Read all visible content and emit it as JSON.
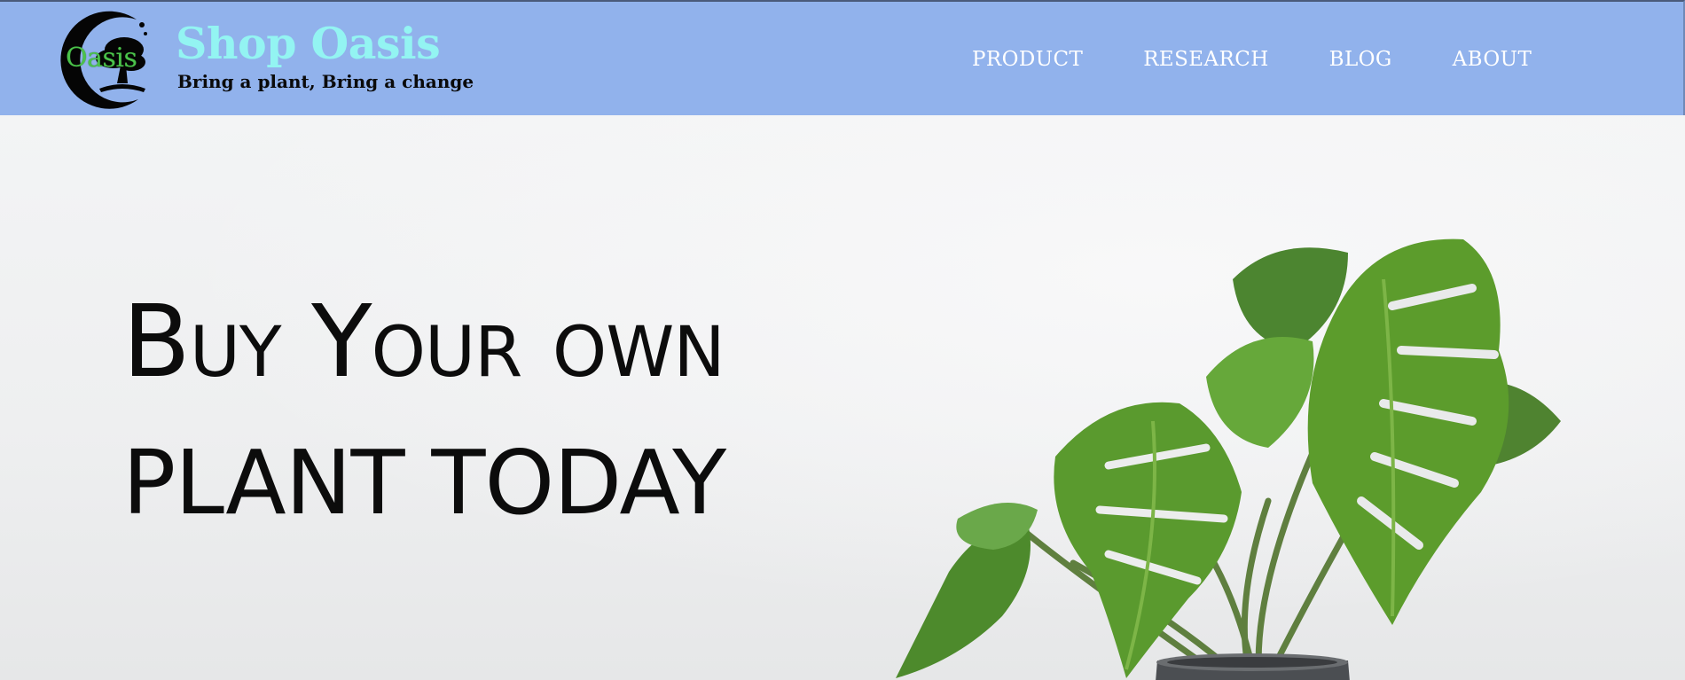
{
  "header": {
    "logo": {
      "icon": "tree-icon",
      "word": "Oasis"
    },
    "brand_title": "Shop Oasis",
    "tagline": "Bring a plant, Bring a change",
    "nav": [
      {
        "label": "PRODUCT"
      },
      {
        "label": "RESEARCH"
      },
      {
        "label": "BLOG"
      },
      {
        "label": "ABOUT"
      }
    ]
  },
  "hero": {
    "headline_line1": "Buy Your own",
    "headline_line2": "plant today",
    "image": "monstera-plant-in-pot"
  },
  "colors": {
    "header_bg": "#91b2ec",
    "brand_title": "#93f4f2",
    "logo_word": "#4bc24b",
    "nav_text": "#ffffff",
    "hero_text": "#0c0c0c",
    "leaf": "#5a9a2e",
    "pot": "#4b4e52"
  }
}
